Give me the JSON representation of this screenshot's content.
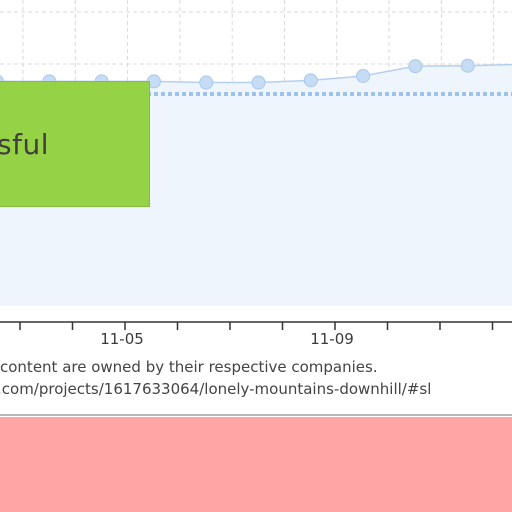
{
  "status_badge": {
    "text": "sful",
    "color": "#95d246"
  },
  "chart_data": {
    "type": "area",
    "x_tick_labels": [
      "11-05",
      "11-09"
    ],
    "series": [
      {
        "values": [
          1000,
          1000,
          1000,
          1000,
          995,
          995,
          1005,
          1025,
          1070,
          1072,
          1078,
          1090
        ]
      }
    ],
    "reference_line": 1030,
    "ylim": [
      0,
      1400
    ],
    "grid": true,
    "colors": {
      "line": "#b4d0ef",
      "marker": "#c6dcf4",
      "fill": "#eef5fd",
      "reference": "#9dc2ec"
    }
  },
  "footer": {
    "copyright": "content are owned by their respective companies.",
    "url": ".com/projects/1617633064/lonely-mountains-downhill/#sl"
  },
  "error_panel": {
    "color": "#ffa5a5"
  }
}
